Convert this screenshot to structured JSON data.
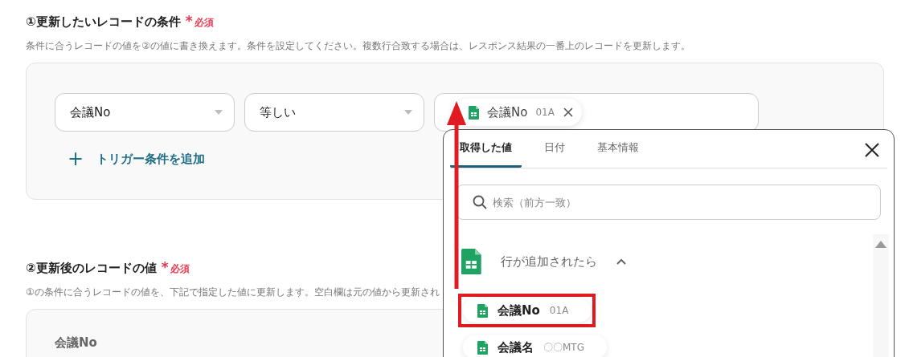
{
  "section_1": {
    "title": "①更新したいレコードの条件",
    "required": {
      "mark": "*",
      "label": "必須"
    },
    "description": "条件に合うレコードの値を②の値に書き換えます。条件を設定してください。複数行合致する場合は、レスポンス結果の一番上のレコードを更新します。",
    "conditions": [
      {
        "field": "会議No",
        "operator": "等しい",
        "value_chip": {
          "label": "会議No",
          "sample": "01A"
        }
      }
    ],
    "add_button": {
      "icon": "+",
      "label": "トリガー条件を追加"
    }
  },
  "section_2": {
    "title": "②更新後のレコードの値",
    "required": {
      "mark": "*",
      "label": "必須"
    },
    "description": "①の条件に合うレコードの値を、下記で指定した値に更新します。空白欄は元の値から更新され",
    "fields": [
      {
        "label": "会議No"
      }
    ]
  },
  "popup": {
    "tabs": [
      {
        "label": "取得した値",
        "selected": true
      },
      {
        "label": "日付",
        "selected": false
      },
      {
        "label": "基本情報",
        "selected": false
      }
    ],
    "search": {
      "placeholder": "検索（前方一致）"
    },
    "group": {
      "title": "行が追加されたら",
      "expanded": true,
      "items": [
        {
          "label": "会議No",
          "sample": "01A",
          "highlighted": true
        },
        {
          "label": "会議名",
          "sample": "〇〇MTG",
          "highlighted": false
        }
      ]
    }
  }
}
